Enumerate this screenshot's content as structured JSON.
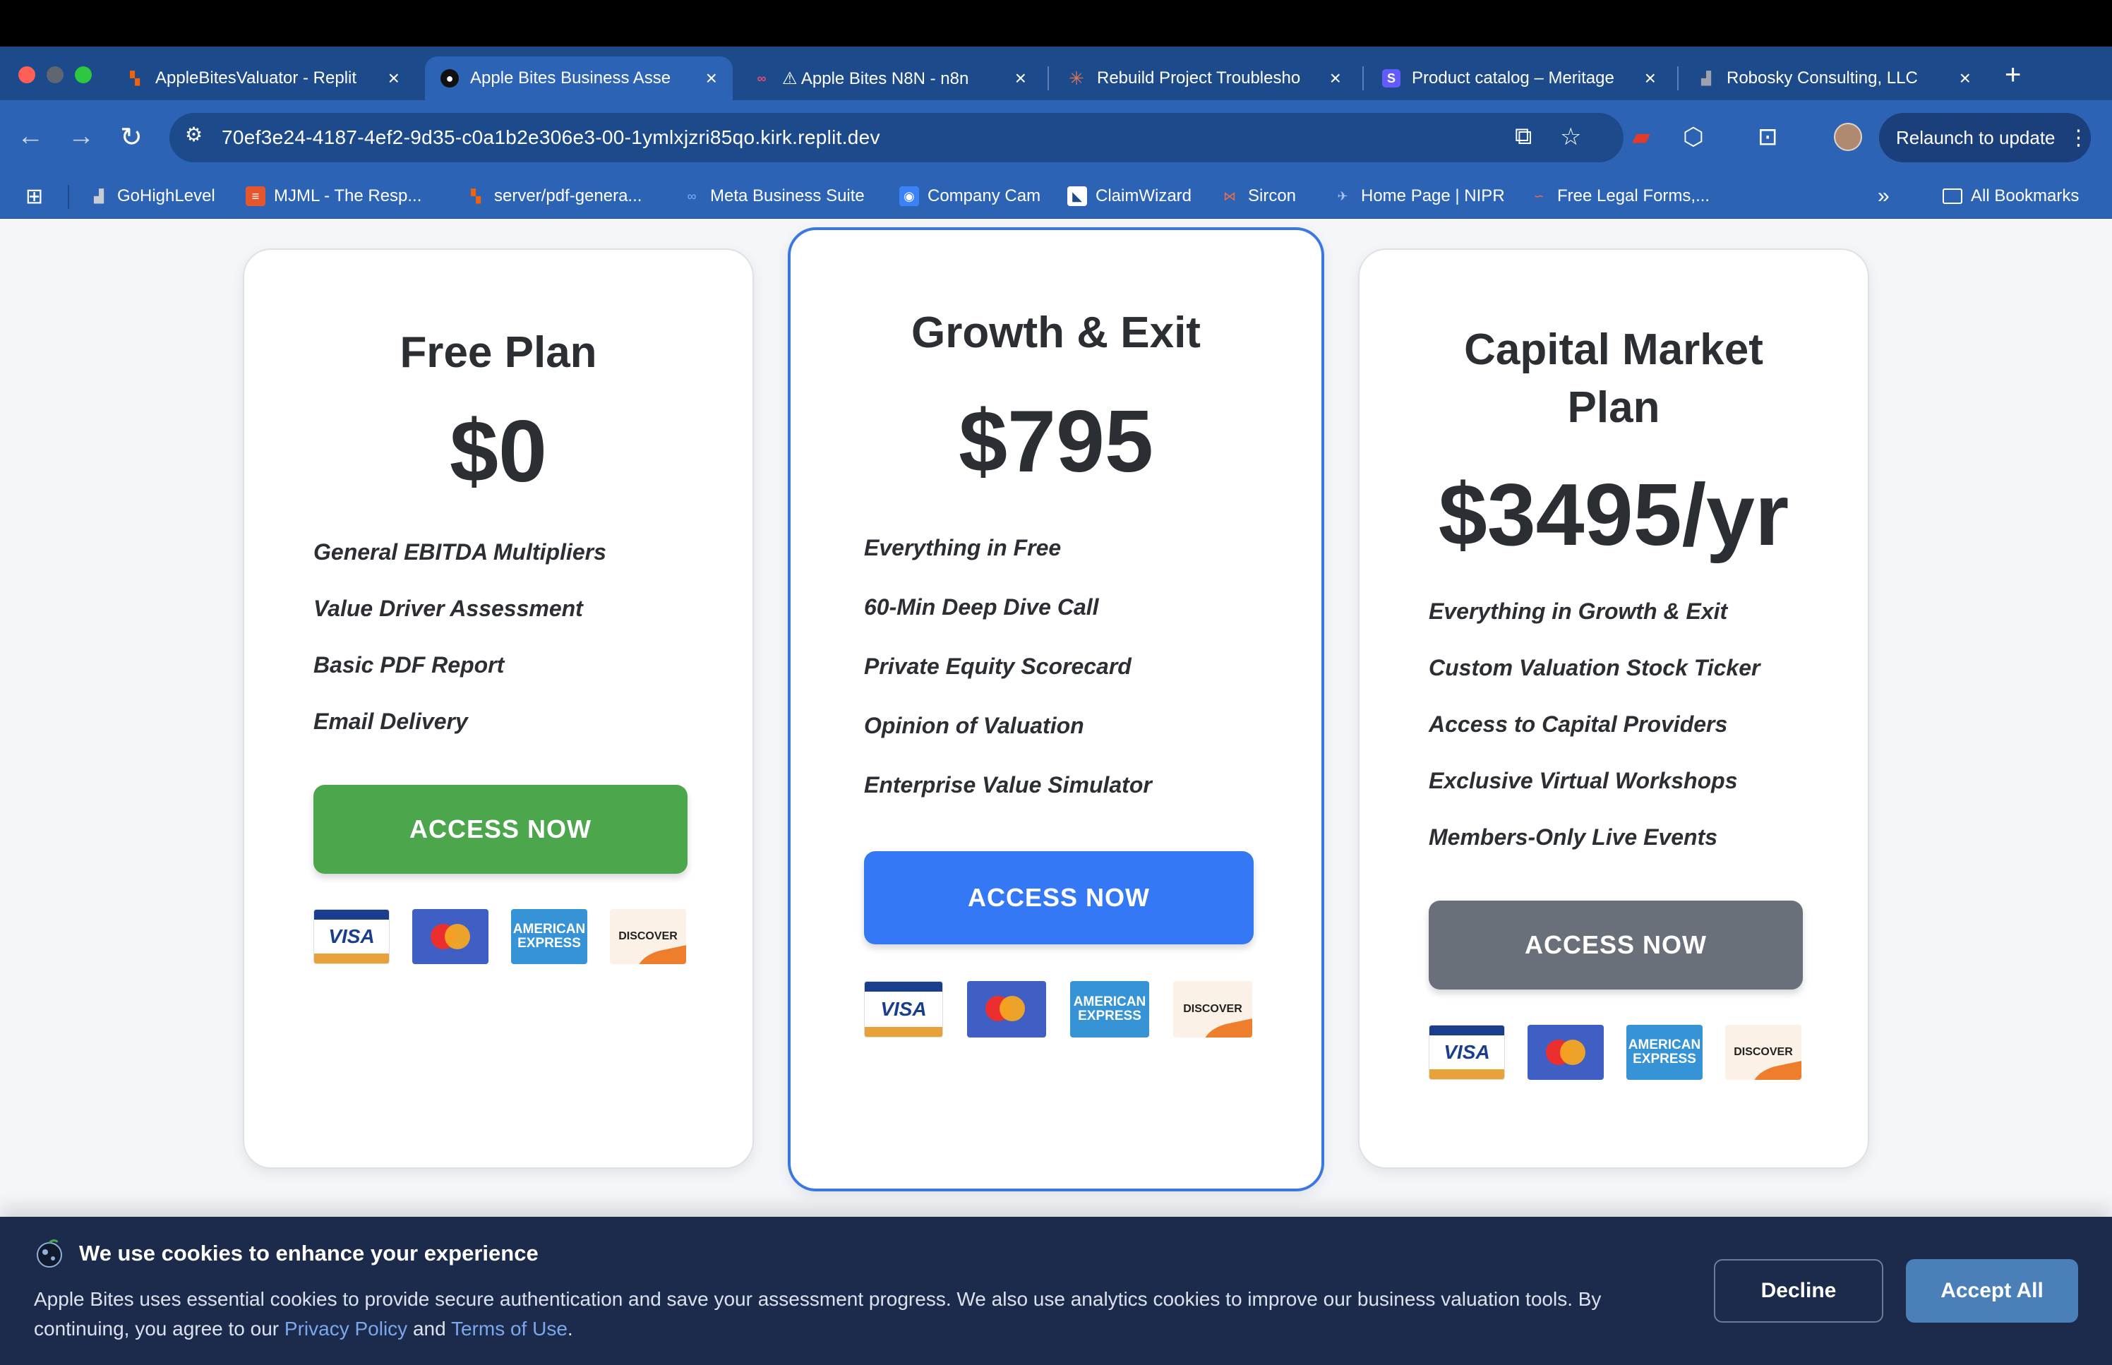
{
  "browser": {
    "tabs": [
      {
        "title": "AppleBitesValuator - Replit",
        "color": "#f26207",
        "glyph": "▚"
      },
      {
        "title": "Apple Bites Business Asse",
        "color": "#1a1a1a",
        "glyph": "●"
      },
      {
        "title": "⚠ Apple Bites N8N - n8n",
        "color": "#ea4b71",
        "glyph": "∞"
      },
      {
        "title": "Rebuild Project Troublesho",
        "color": "#d97757",
        "glyph": "✳"
      },
      {
        "title": "Product catalog – Meritage",
        "color": "#635bff",
        "glyph": "S"
      },
      {
        "title": "Robosky Consulting, LLC",
        "color": "#6b7280",
        "glyph": "▟"
      }
    ],
    "url": "70ef3e24-4187-4ef2-9d35-c0a1b2e306e3-00-1ymlxjzri85qo.kirk.replit.dev",
    "relaunch_label": "Relaunch to update",
    "bookmarks": [
      {
        "label": "GoHighLevel",
        "color": "#6b7280",
        "glyph": "▟"
      },
      {
        "label": "MJML - The Resp...",
        "color": "#e4572e",
        "glyph": "≡"
      },
      {
        "label": "server/pdf-genera...",
        "color": "#f26207",
        "glyph": "▚"
      },
      {
        "label": "Meta Business Suite",
        "color": "#2c63b5",
        "glyph": "∞"
      },
      {
        "label": "Company Cam",
        "color": "#3b82f6",
        "glyph": "◉"
      },
      {
        "label": "ClaimWizard",
        "color": "#ffffff",
        "glyph": "◣"
      },
      {
        "label": "Sircon",
        "color": "#e4572e",
        "glyph": "⋈"
      },
      {
        "label": "Home Page | NIPR",
        "color": "#2c63b5",
        "glyph": "✈"
      },
      {
        "label": "Free Legal Forms,...",
        "color": "#e4572e",
        "glyph": "∽"
      }
    ],
    "all_bookmarks_label": "All Bookmarks"
  },
  "plans": [
    {
      "title": "Free Plan",
      "price": "$0",
      "features": [
        "General EBITDA Multipliers",
        "Value Driver Assessment",
        "Basic PDF Report",
        "Email Delivery"
      ],
      "cta": "ACCESS NOW",
      "cta_color": "#4ca64c"
    },
    {
      "title": "Growth & Exit",
      "price": "$795",
      "features": [
        "Everything in Free",
        "60-Min Deep Dive Call",
        "Private Equity Scorecard",
        "Opinion of Valuation",
        "Enterprise Value Simulator"
      ],
      "cta": "ACCESS NOW",
      "cta_color": "#3478f6"
    },
    {
      "title_line1": "Capital Market",
      "title_line2": "Plan",
      "price": "$3495/yr",
      "features": [
        "Everything in Growth & Exit",
        "Custom Valuation Stock Ticker",
        "Access to Capital Providers",
        "Exclusive Virtual Workshops",
        "Members-Only Live Events"
      ],
      "cta": "ACCESS NOW",
      "cta_color": "#6a7079"
    }
  ],
  "payment_cards": {
    "visa": "VISA",
    "amex_line1": "AMERICAN",
    "amex_line2": "EXPRESS",
    "discover": "DISCOVER"
  },
  "cookie": {
    "title": "We use cookies to enhance your experience",
    "body_text": "Apple Bites uses essential cookies to provide secure authentication and save your assessment progress. We also use analytics cookies to improve our business valuation tools. By continuing, you agree to our ",
    "privacy_link": "Privacy Policy",
    "and": " and ",
    "terms_link": "Terms of Use",
    "period": ".",
    "decline": "Decline",
    "accept": "Accept All"
  }
}
